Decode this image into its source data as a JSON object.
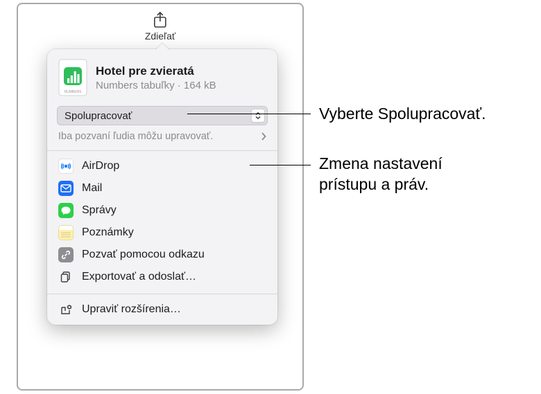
{
  "share_button": {
    "label": "Zdieľať"
  },
  "popover": {
    "doc": {
      "title": "Hotel pre zvieratá",
      "subtitle": "Numbers tabuľky · 164 kB"
    },
    "mode_select": {
      "value": "Spolupracovať"
    },
    "permissions": {
      "text": "Iba pozvaní ľudia môžu upravovať."
    },
    "menu": {
      "airdrop": "AirDrop",
      "mail": "Mail",
      "messages": "Správy",
      "notes": "Poznámky",
      "invite_link": "Pozvať pomocou odkazu",
      "export_send": "Exportovať a odoslať…",
      "edit_extensions": "Upraviť rozšírenia…"
    }
  },
  "callouts": {
    "c1": "Vyberte Spolupracovať.",
    "c2": "Zmena nastavení prístupu a práv."
  }
}
